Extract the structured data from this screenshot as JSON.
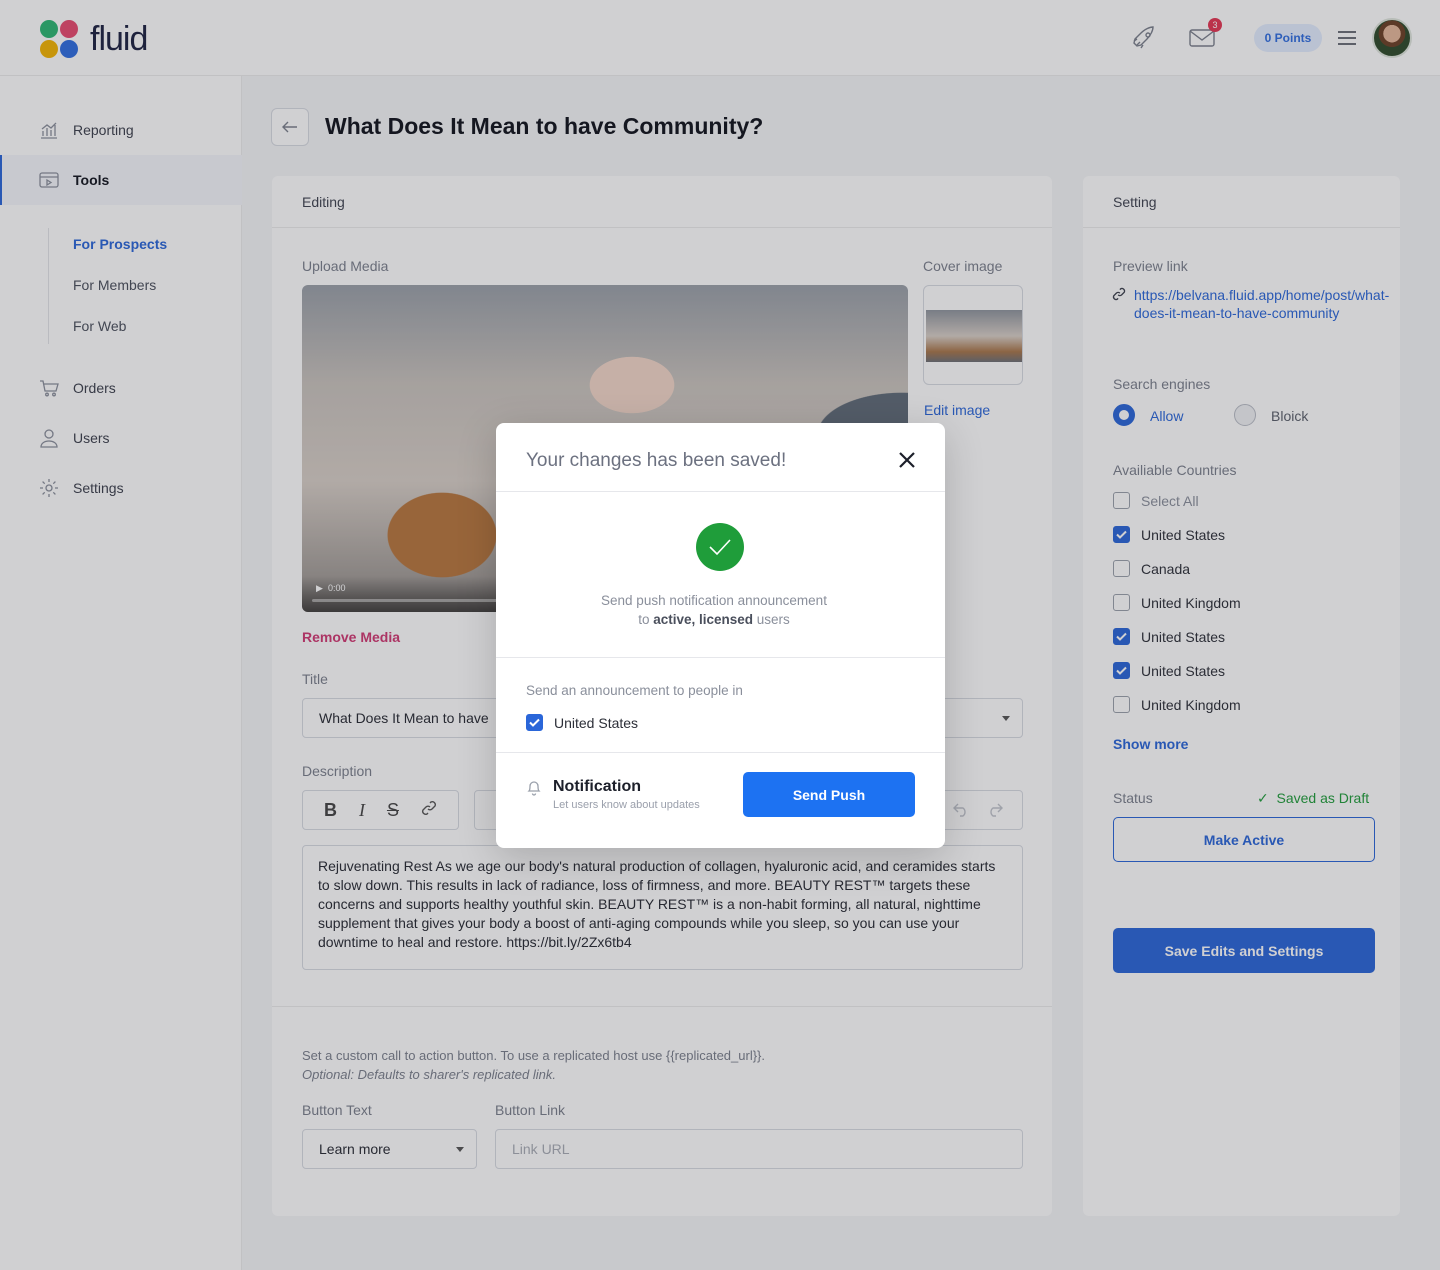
{
  "app": {
    "brand": "fluid",
    "points_label": "0 Points",
    "mail_badge": "3"
  },
  "sidebar": {
    "items": [
      {
        "label": "Reporting",
        "icon": "chart-icon"
      },
      {
        "label": "Tools",
        "icon": "tools-icon"
      },
      {
        "label": "Orders",
        "icon": "cart-icon"
      },
      {
        "label": "Users",
        "icon": "user-icon"
      },
      {
        "label": "Settings",
        "icon": "gear-icon"
      }
    ],
    "sub_items": [
      "For Prospects",
      "For Members",
      "For Web"
    ]
  },
  "page": {
    "title": "What Does It Mean to have Community?"
  },
  "editing": {
    "header": "Editing",
    "upload_label": "Upload Media",
    "cover_label": "Cover image",
    "edit_image": "Edit image",
    "video_time": "0:00",
    "remove_media": "Remove Media",
    "title_label": "Title",
    "title_value": "What Does It Mean to have",
    "description_label": "Description",
    "toolbar": {
      "bold": "B",
      "italic": "I",
      "strike": "S"
    },
    "description_text": "Rejuvenating Rest As we age our body's natural production of collagen, hyaluronic acid, and ceramides starts to slow down. This results in lack of radiance, loss of firmness, and more. BEAUTY REST™ targets these concerns and supports healthy youthful skin. BEAUTY REST™ is a non-habit forming, all natural, nighttime supplement that gives your body a boost of anti-aging compounds while you sleep, so you can use your downtime to heal and restore. https://bit.ly/2Zx6tb4",
    "cta_help_line1": "Set a custom call to action button. To use a replicated host use {{replicated_url}}.",
    "cta_help_line2": "Optional: Defaults to sharer's replicated link.",
    "button_text_label": "Button Text",
    "button_text_value": "Learn more",
    "button_link_label": "Button Link",
    "button_link_placeholder": "Link URL"
  },
  "setting": {
    "header": "Setting",
    "preview_label": "Preview link",
    "preview_url": "https://belvana.fluid.app/home/post/what-does-it-mean-to-have-community",
    "search_label": "Search engines",
    "allow": "Allow",
    "block": "Bloick",
    "countries_label": "Availiable Countries",
    "countries": [
      {
        "name": "Select All",
        "checked": false
      },
      {
        "name": "United States",
        "checked": true
      },
      {
        "name": "Canada",
        "checked": false
      },
      {
        "name": "United Kingdom",
        "checked": false
      },
      {
        "name": "United States",
        "checked": true
      },
      {
        "name": "United States",
        "checked": true
      },
      {
        "name": "United Kingdom",
        "checked": false
      }
    ],
    "show_more": "Show more",
    "status_label": "Status",
    "status_value": "Saved as Draft",
    "make_active": "Make Active",
    "save_button": "Save Edits and Settings"
  },
  "modal": {
    "title": "Your changes has been saved!",
    "message_line1": "Send push notification announcement",
    "message_prefix": "to ",
    "message_bold": "active, licensed",
    "message_suffix": " users",
    "announce_label": "Send an announcement to people in",
    "country": "United States",
    "notification_title": "Notification",
    "notification_sub": "Let users know about updates",
    "send_button": "Send Push"
  },
  "colors": {
    "accent": "#2a66d9",
    "success": "#1f9d3a",
    "danger": "#d13873",
    "send": "#1d72f2"
  }
}
